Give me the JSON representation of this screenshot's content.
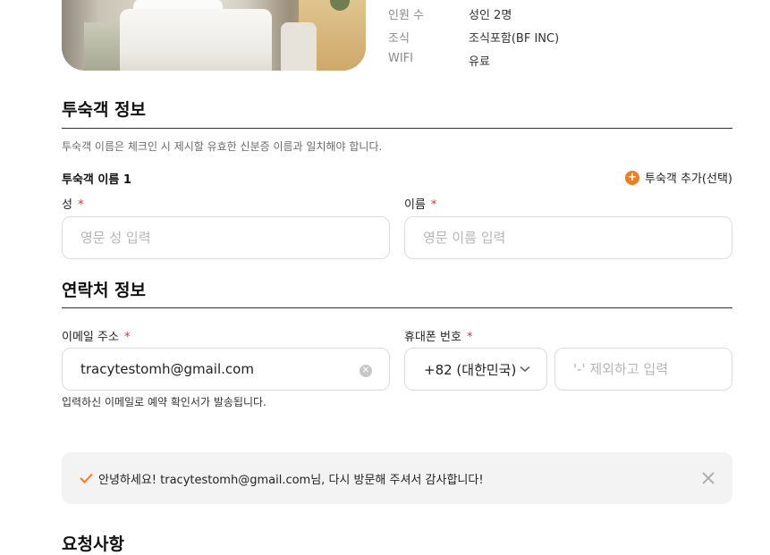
{
  "room": {
    "info": [
      {
        "label": "인원 수",
        "value": "성인 2명"
      },
      {
        "label": "조식",
        "value": "조식포함(BF INC)"
      },
      {
        "label": "WIFI",
        "value": "유료"
      }
    ]
  },
  "guest": {
    "title": "투숙객 정보",
    "notice": "투숙객 이름은 체크인 시 제시할 유효한 신분증 이름과 일치해야 합니다.",
    "guest_label": "투숙객 이름 1",
    "add_guest_label": "투숙객 추가(선택)",
    "last_name_label": "성",
    "last_name_placeholder": "영문 성 입력",
    "first_name_label": "이름",
    "first_name_placeholder": "영문 이름 입력",
    "required_mark": "*"
  },
  "contact": {
    "title": "연락처 정보",
    "email_label": "이메일 주소",
    "email_value": "tracytestomh@gmail.com",
    "email_helper": "입력하신 이메일로 예약 확인서가 발송됩니다.",
    "phone_label": "휴대폰 번호",
    "country_code": "+82 (대한민국)",
    "phone_placeholder": "'-' 제외하고 입력",
    "required_mark": "*"
  },
  "banner": {
    "message": "안녕하세요! tracytestomh@gmail.com님, 다시 방문해 주셔서 감사합니다!"
  },
  "request": {
    "title": "요청사항"
  },
  "colors": {
    "accent": "#f47b20",
    "required": "#e8322d"
  }
}
